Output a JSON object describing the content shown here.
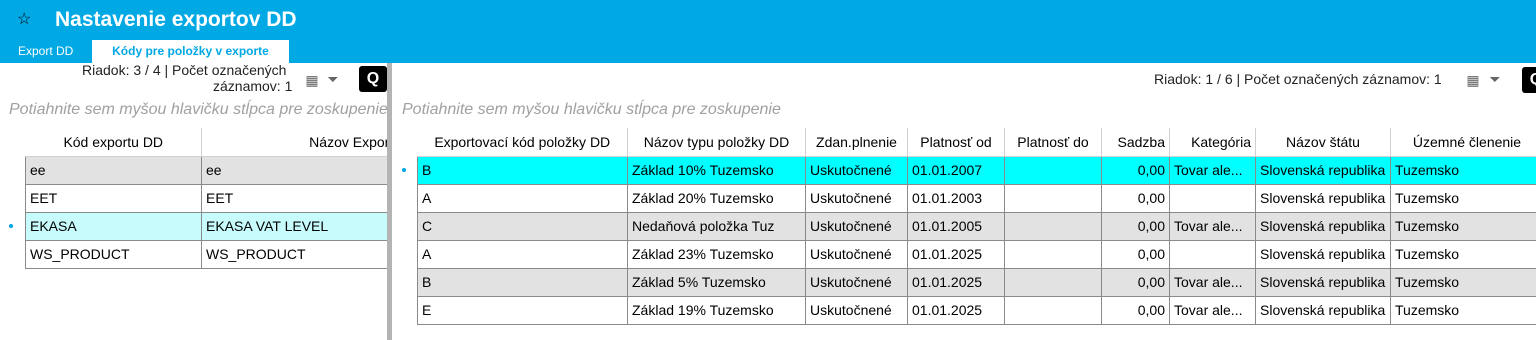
{
  "app": {
    "title": "Nastavenie exportov DD"
  },
  "tabs": [
    {
      "label": "Export DD"
    },
    {
      "label": "Kódy pre položky v exporte"
    }
  ],
  "left_panel": {
    "status_line1": "Riadok: 3 / 4 | Počet označených",
    "status_line2": "záznamov: 1",
    "group_hint": "Potiahnite sem myšou hlavičku stĺpca pre zoskupenie",
    "columns": [
      "Kód exportu DD",
      "Názov Exportu"
    ],
    "rows": [
      [
        "ee",
        "ee"
      ],
      [
        "EET",
        "EET"
      ],
      [
        "EKASA",
        "EKASA VAT LEVEL"
      ],
      [
        "WS_PRODUCT",
        "WS_PRODUCT"
      ]
    ]
  },
  "right_panel": {
    "status": "Riadok: 1 / 6 | Počet označených záznamov: 1",
    "group_hint": "Potiahnite sem myšou hlavičku stĺpca pre zoskupenie",
    "columns": [
      "Exportovací kód položky DD",
      "Názov typu položky DD",
      "Zdan.plnenie",
      "Platnosť od",
      "Platnosť do",
      "Sadzba",
      "Kategória",
      "Názov štátu",
      "Územné členenie"
    ],
    "rows": [
      [
        "B",
        "Základ 10% Tuzemsko",
        "Uskutočnené",
        "01.01.2007",
        "",
        "0,00",
        "Tovar ale...",
        "Slovenská republika",
        "Tuzemsko"
      ],
      [
        "A",
        "Základ 20% Tuzemsko",
        "Uskutočnené",
        "01.01.2003",
        "",
        "0,00",
        "",
        "Slovenská republika",
        "Tuzemsko"
      ],
      [
        "C",
        "Nedaňová položka Tuz",
        "Uskutočnené",
        "01.01.2005",
        "",
        "0,00",
        "Tovar ale...",
        "Slovenská republika",
        "Tuzemsko"
      ],
      [
        "A",
        "Základ 23% Tuzemsko",
        "Uskutočnené",
        "01.01.2025",
        "",
        "0,00",
        "",
        "Slovenská republika",
        "Tuzemsko"
      ],
      [
        "B",
        "Základ 5% Tuzemsko",
        "Uskutočnené",
        "01.01.2025",
        "",
        "0,00",
        "Tovar ale...",
        "Slovenská republika",
        "Tuzemsko"
      ],
      [
        "E",
        "Základ 19% Tuzemsko",
        "Uskutočnené",
        "01.01.2025",
        "",
        "0,00",
        "Tovar ale...",
        "Slovenská republika",
        "Tuzemsko"
      ]
    ]
  },
  "icons": [
    "star-icon",
    "export-grid-icon",
    "filter-icon",
    "quick-search-icon"
  ],
  "colors": {
    "header": "#00a8e4",
    "selected_row": "#00ffff",
    "selected_light": "#c8fcfc",
    "alt_row": "#e2e2e2"
  }
}
